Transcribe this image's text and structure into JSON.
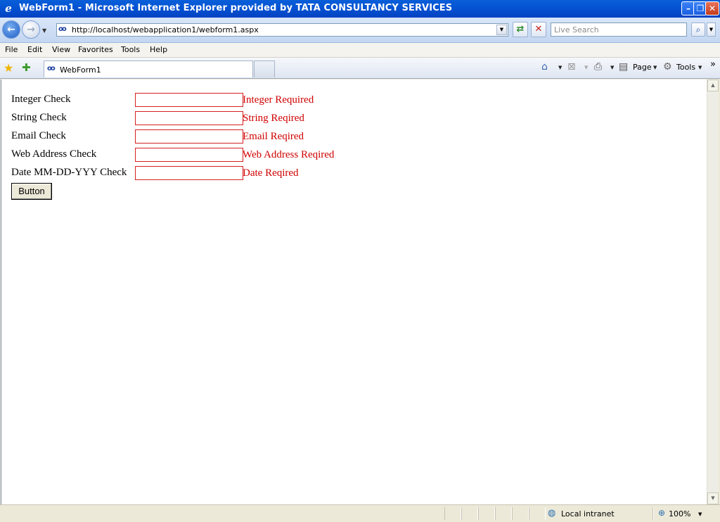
{
  "window": {
    "title": "WebForm1 - Microsoft Internet Explorer provided by TATA CONSULTANCY SERVICES",
    "app_icon": "e",
    "min_glyph": "–",
    "max_glyph": "❐",
    "close_glyph": "✕"
  },
  "navigation": {
    "back_glyph": "←",
    "forward_glyph": "→",
    "address_url": "http://localhost/webapplication1/webform1.aspx",
    "search_placeholder": "Live Search",
    "refresh_glyph": "⇄",
    "stop_glyph": "✕",
    "search_glyph": "⌕"
  },
  "menu": {
    "items": [
      "File",
      "Edit",
      "View",
      "Favorites",
      "Tools",
      "Help"
    ]
  },
  "tabs": {
    "active_tab_label": "WebForm1",
    "favicon": "oo"
  },
  "commandbar": {
    "page_label": "Page",
    "tools_label": "Tools",
    "more_glyph": "»"
  },
  "form": {
    "rows": [
      {
        "label": "Integer Check",
        "value": "",
        "error": "Integer Required"
      },
      {
        "label": "String Check",
        "value": "",
        "error": "String Reqired"
      },
      {
        "label": "Email Check",
        "value": "",
        "error": "Email Reqired"
      },
      {
        "label": "Web Address Check",
        "value": "",
        "error": "Web Address Reqired"
      },
      {
        "label": "Date MM-DD-YYY Check",
        "value": "",
        "error": "Date Reqired"
      }
    ],
    "button_label": "Button",
    "error_color": "#d00000"
  },
  "statusbar": {
    "zone_label": "Local intranet",
    "zoom_label": "100%"
  }
}
